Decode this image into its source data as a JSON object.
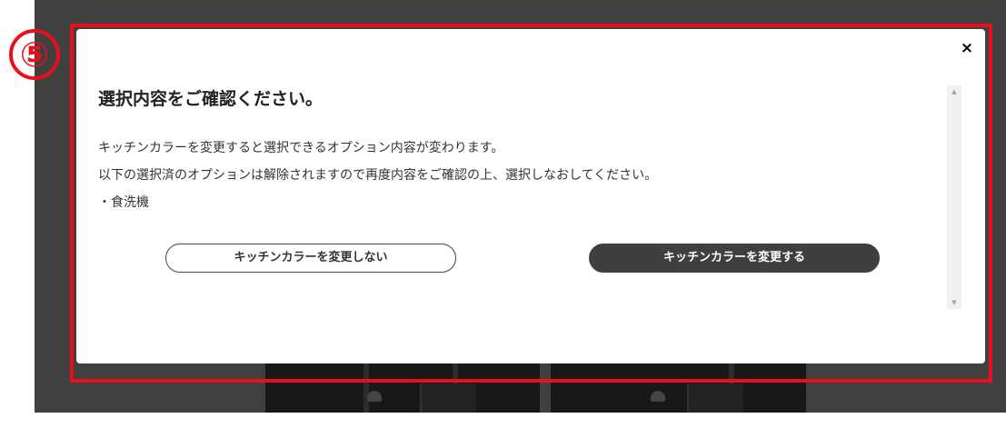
{
  "annotation": {
    "number": "⑤",
    "color": "#e8101a"
  },
  "modal": {
    "close_label": "×",
    "title": "選択内容をご確認ください。",
    "lines": [
      "キッチンカラーを変更すると選択できるオプション内容が変わります。",
      "以下の選択済のオプションは解除されますので再度内容をご確認の上、選択しなおしてください。",
      "・食洗機"
    ],
    "cancel_button": "キッチンカラーを変更しない",
    "confirm_button": "キッチンカラーを変更する"
  },
  "scrollbar": {
    "up_arrow": "▲",
    "down_arrow": "▼"
  },
  "colors": {
    "backdrop": "#404040",
    "primary_button": "#3f3f3f",
    "highlight": "#e8101a"
  }
}
